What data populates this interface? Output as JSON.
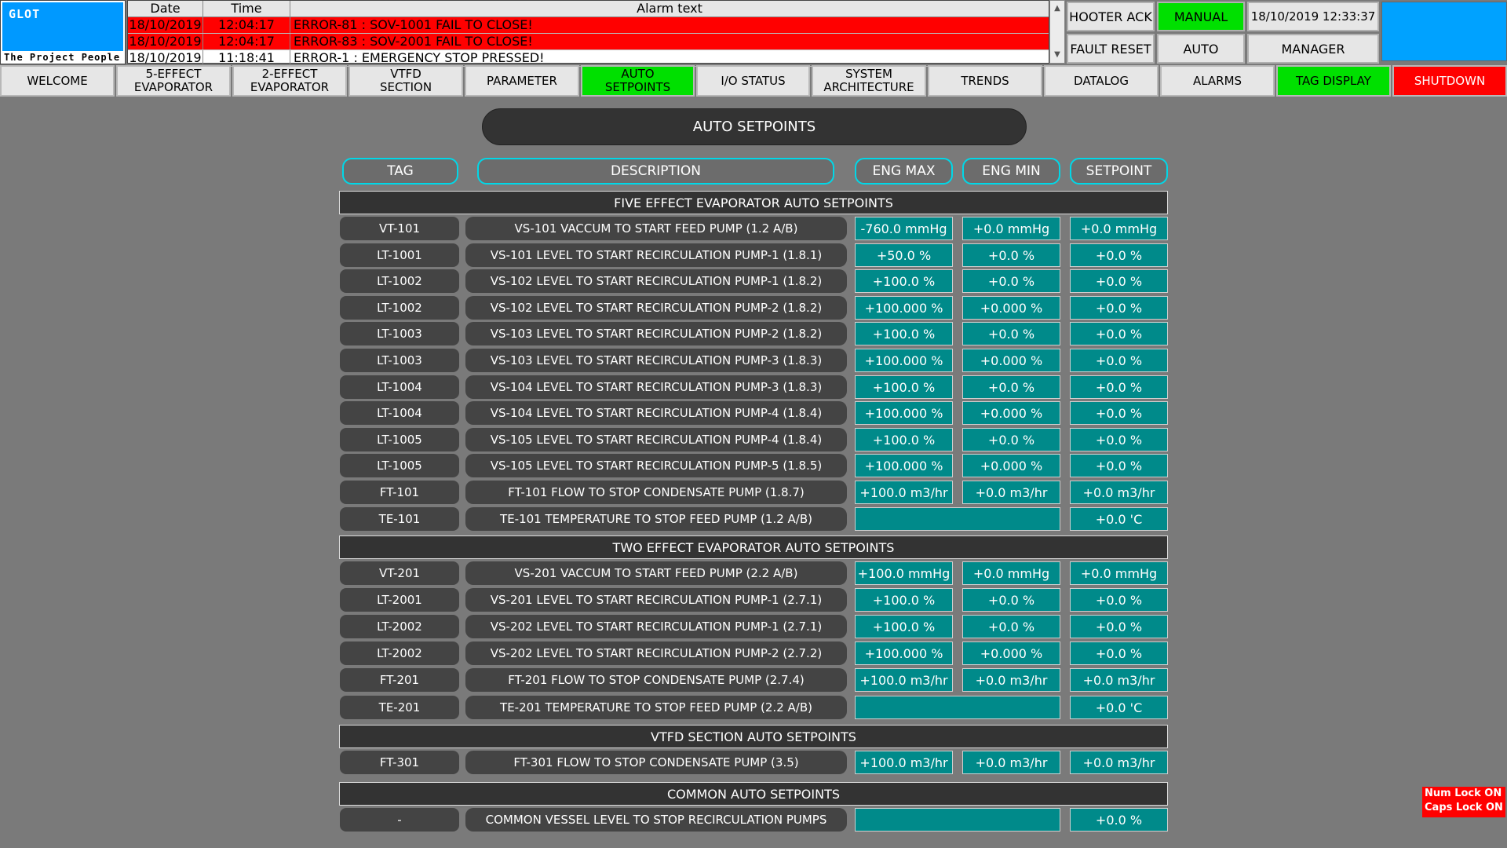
{
  "logo": {
    "mark": "GLOT",
    "tagline": "The Project  People"
  },
  "alarms": {
    "headers": {
      "date": "Date",
      "time": "Time",
      "text": "Alarm text"
    },
    "rows": [
      {
        "date": "18/10/2019",
        "time": "12:04:17",
        "text": "ERROR-81 : SOV-1001 FAIL TO CLOSE!",
        "active": true
      },
      {
        "date": "18/10/2019",
        "time": "12:04:17",
        "text": "ERROR-83 : SOV-2001 FAIL TO CLOSE!",
        "active": true
      },
      {
        "date": "18/10/2019",
        "time": "11:18:41",
        "text": "ERROR-1 : EMERGENCY STOP PRESSED!",
        "active": false
      }
    ]
  },
  "top_buttons": {
    "hooter_ack": "HOOTER ACK",
    "fault_reset": "FAULT RESET",
    "manual": "MANUAL",
    "auto": "AUTO",
    "datetime": "18/10/2019 12:33:37",
    "manager": "MANAGER"
  },
  "colors": {
    "active": "#00e000",
    "alarm": "#ff0000",
    "value_bg": "#008a8a",
    "header_border": "#00d8e8",
    "ext_box": "#00a2ff"
  },
  "nav": [
    {
      "id": "welcome",
      "label": "WELCOME"
    },
    {
      "id": "5-effect-evaporator",
      "label": "5-EFFECT\nEVAPORATOR"
    },
    {
      "id": "2-effect-evaporator",
      "label": "2-EFFECT\nEVAPORATOR"
    },
    {
      "id": "vtfd-section",
      "label": "VTFD\nSECTION"
    },
    {
      "id": "parameter",
      "label": "PARAMETER"
    },
    {
      "id": "auto-setpoints",
      "label": "AUTO\nSETPOINTS",
      "active": true
    },
    {
      "id": "io-status",
      "label": "I/O STATUS"
    },
    {
      "id": "system-architecture",
      "label": "SYSTEM\nARCHITECTURE"
    },
    {
      "id": "trends",
      "label": "TRENDS"
    },
    {
      "id": "datalog",
      "label": "DATALOG"
    },
    {
      "id": "alarms",
      "label": "ALARMS"
    },
    {
      "id": "tag-display",
      "label": "TAG DISPLAY",
      "highlight": "green"
    },
    {
      "id": "shutdown",
      "label": "SHUTDOWN",
      "highlight": "red"
    }
  ],
  "page_title": "AUTO SETPOINTS",
  "columns": {
    "tag": "TAG",
    "description": "DESCRIPTION",
    "eng_max": "ENG MAX",
    "eng_min": "ENG MIN",
    "setpoint": "SETPOINT"
  },
  "sections": [
    {
      "title": "FIVE EFFECT EVAPORATOR AUTO SETPOINTS",
      "rows": [
        {
          "tag": "VT-101",
          "desc": "VS-101 VACCUM TO START FEED PUMP (1.2 A/B)",
          "max": "-760.0 mmHg",
          "min": "+0.0 mmHg",
          "sp": "+0.0 mmHg"
        },
        {
          "tag": "LT-1001",
          "desc": "VS-101 LEVEL TO START RECIRCULATION PUMP-1 (1.8.1)",
          "max": "+50.0 %",
          "min": "+0.0 %",
          "sp": "+0.0 %"
        },
        {
          "tag": "LT-1002",
          "desc": "VS-102 LEVEL TO START RECIRCULATION PUMP-1 (1.8.2)",
          "max": "+100.0 %",
          "min": "+0.0 %",
          "sp": "+0.0 %"
        },
        {
          "tag": "LT-1002",
          "desc": "VS-102 LEVEL TO START RECIRCULATION PUMP-2 (1.8.2)",
          "max": "+100.000 %",
          "min": "+0.000 %",
          "sp": "+0.0 %"
        },
        {
          "tag": "LT-1003",
          "desc": "VS-103 LEVEL TO START RECIRCULATION PUMP-2 (1.8.2)",
          "max": "+100.0 %",
          "min": "+0.0 %",
          "sp": "+0.0 %"
        },
        {
          "tag": "LT-1003",
          "desc": "VS-103 LEVEL TO START RECIRCULATION PUMP-3 (1.8.3)",
          "max": "+100.000 %",
          "min": "+0.000 %",
          "sp": "+0.0 %"
        },
        {
          "tag": "LT-1004",
          "desc": "VS-104 LEVEL TO START RECIRCULATION PUMP-3 (1.8.3)",
          "max": "+100.0 %",
          "min": "+0.0 %",
          "sp": "+0.0 %"
        },
        {
          "tag": "LT-1004",
          "desc": "VS-104 LEVEL TO START RECIRCULATION PUMP-4 (1.8.4)",
          "max": "+100.000 %",
          "min": "+0.000 %",
          "sp": "+0.0 %"
        },
        {
          "tag": "LT-1005",
          "desc": "VS-105 LEVEL TO START RECIRCULATION PUMP-4 (1.8.4)",
          "max": "+100.0 %",
          "min": "+0.0 %",
          "sp": "+0.0 %"
        },
        {
          "tag": "LT-1005",
          "desc": "VS-105 LEVEL TO START RECIRCULATION PUMP-5 (1.8.5)",
          "max": "+100.000 %",
          "min": "+0.000 %",
          "sp": "+0.0 %"
        },
        {
          "tag": "FT-101",
          "desc": "FT-101 FLOW TO STOP CONDENSATE PUMP (1.8.7)",
          "max": "+100.0 m3/hr",
          "min": "+0.0 m3/hr",
          "sp": "+0.0 m3/hr"
        },
        {
          "tag": "TE-101",
          "desc": "TE-101 TEMPERATURE TO STOP FEED PUMP (1.2 A/B)",
          "merged": true,
          "sp": "+0.0 'C"
        }
      ]
    },
    {
      "title": "TWO EFFECT EVAPORATOR AUTO SETPOINTS",
      "rows": [
        {
          "tag": "VT-201",
          "desc": "VS-201 VACCUM TO START FEED PUMP (2.2 A/B)",
          "max": "+100.0 mmHg",
          "min": "+0.0 mmHg",
          "sp": "+0.0 mmHg"
        },
        {
          "tag": "LT-2001",
          "desc": "VS-201 LEVEL TO START RECIRCULATION PUMP-1 (2.7.1)",
          "max": "+100.0 %",
          "min": "+0.0 %",
          "sp": "+0.0 %"
        },
        {
          "tag": "LT-2002",
          "desc": "VS-202 LEVEL TO START RECIRCULATION PUMP-1 (2.7.1)",
          "max": "+100.0 %",
          "min": "+0.0 %",
          "sp": "+0.0 %"
        },
        {
          "tag": "LT-2002",
          "desc": "VS-202 LEVEL TO START RECIRCULATION PUMP-2 (2.7.2)",
          "max": "+100.000 %",
          "min": "+0.000 %",
          "sp": "+0.0 %"
        },
        {
          "tag": "FT-201",
          "desc": "FT-201 FLOW TO STOP CONDENSATE PUMP (2.7.4)",
          "max": "+100.0 m3/hr",
          "min": "+0.0 m3/hr",
          "sp": "+0.0 m3/hr"
        },
        {
          "tag": "TE-201",
          "desc": "TE-201 TEMPERATURE TO STOP FEED PUMP (2.2 A/B)",
          "merged": true,
          "sp": "+0.0 'C"
        }
      ]
    },
    {
      "title": "VTFD SECTION AUTO SETPOINTS",
      "rows": [
        {
          "tag": "FT-301",
          "desc": "FT-301 FLOW TO STOP CONDENSATE PUMP (3.5)",
          "max": "+100.0 m3/hr",
          "min": "+0.0 m3/hr",
          "sp": "+0.0 m3/hr"
        }
      ]
    },
    {
      "title": "COMMON AUTO SETPOINTS",
      "rows": [
        {
          "tag": "-",
          "desc": "COMMON VESSEL LEVEL TO STOP RECIRCULATION PUMPS",
          "merged": true,
          "sp": "+0.0 %"
        }
      ]
    }
  ],
  "lock_status": {
    "num": "Num Lock ON",
    "caps": "Caps Lock ON"
  }
}
